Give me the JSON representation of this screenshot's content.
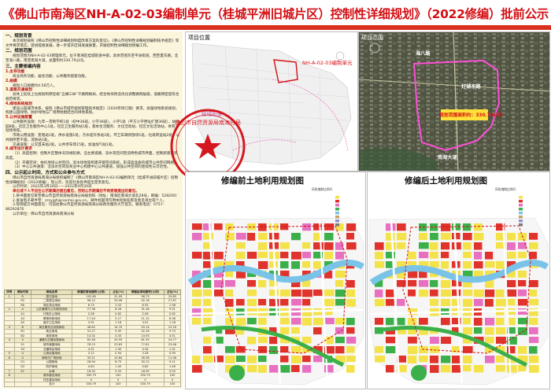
{
  "title": "《佛山市南海区NH-A-02-03编制单元（桂城平洲旧城片区）控制性详细规划》（2022修编）批前公示",
  "left": {
    "sec1_h": "一、规划背景",
    "sec1_p": "本次规划按照《佛山市控制性详细规划制度改革方案的意见》、《佛山市控制性详细规划编制技术规定》等文件要求落实，促进提质发展，进一步提升区域发展质量，开展控制性详细规划修编工作。",
    "sec2_h": "二、规划范围",
    "sec2_p": "规划范围为NH-A-02-03管理单元，位于南海区桂城街道中部，具体范围东至平洲街道，西至夏东路，北至海八路，南至南海大道，总面积约330.79公顷。",
    "sec3_h": "三、主要修编内容",
    "s1": "1.主导功能",
    "s1_p": "商业商务功能、居住功能、公共服务配套功能。",
    "s2": "2.规模",
    "s2_p": "规划人口规模约4.58万人。",
    "s3": "3.道路交通规划",
    "s3_p": "总体上延续上位规划和原控规“五横三纵”干路网格局，结合地块改造优化调整路网层级，道路网密度符合规范要求。",
    "s4": "4.绿地系统规划",
    "s4_p": "建设公园城市体系，按照《佛山市城市规划管理技术规定》（2020年修订版）要求，加强绿地系统规划，构建公园绿地、防护绿地与广场用地相结合的绿地系统。",
    "s5": "5.公共设施配置",
    "s5_p1": "公共服务设施：九年一贯制学校1处（初中36班，小学36班），小学1处（平方小学原址扩建36班），幼儿园8处，社区卫生服务中心1处，社区卫生服务站1处，基本生活服务、文化活动站、社区文化活动站、体育活动场地等。",
    "s5_p2": "市政公用设施：变电站1处，供水设施1处，污水提升泵站2处，环卫车辆停放场1处，垃圾转运站2处，公共厕所若干座，消防站1处。",
    "s5_p3": "交通设施：公交首末站2处，公共停车场15处，加油加气站1处。",
    "s6": "6.城市设计要求",
    "s6_p1": "（1）高度控制：控制片区整体天际线轮廓，沿主要道路、滨水等空间塑造特色城市界面，控制新建建筑高度。",
    "s6_p2": "（2）开敞空间：依托地块公共空间、滨水绿地等构建开敞空间系统，形成高品质的城市公共空间网络。",
    "s6_p3": "（3）中心公共通道：沿滨水空间及商业中心构建中心公共通道，加强公共空间的连续性与可达性。",
    "s7": "四、公示起止时间、方式和公众参与方式",
    "s7_p1": "佛山市自然资源局南海分局组织编制了《佛山市南海区NH-A-02-03编制单元（桂城平洲旧城片区）控制性详细规划》（2022修编），现公示，欢迎社会各界提出宝贵意见。",
    "s7_p2": "公示时间：2022年3月30日——2022年4月30日",
    "s7_p3": "单位或个人不应在公示期满后提出意见，否则公示期满后不再受理提出的意见。",
    "s7_p4": "1.将书面意见寄至佛山市自然资源局南海分局规划科（地址：南海区南海大道北28号，邮编：528200）",
    "s7_p5": "2.发送电子邮件至：zrzyjgh@nanhai.gov.cn，邮件标题须写明本控规名称及意见单位或个人。",
    "s7_p6": "3.现场提交书面意见：可前往佛山市自然资源局南海分局政务服务大厅提交。联系电话：0757-86292876",
    "org": "公示单位：佛山市自然资源局南海分局",
    "date": "2022年3月"
  },
  "table": {
    "headers": [
      "序号",
      "用地代码",
      "用地名称",
      "修编前用地面积(公顷)",
      "占比(%)",
      "修编后用地面积(公顷)",
      "占比(%)"
    ],
    "rows": [
      [
        "1",
        "R",
        "居住用地",
        "102.85",
        "31.09",
        "98.73",
        "29.85"
      ],
      [
        "",
        "R2",
        "二类居住用地",
        "96.12",
        "29.06",
        "92.18",
        "27.87"
      ],
      [
        "",
        "Rb",
        "商住混合用地",
        "6.73",
        "2.03",
        "6.55",
        "1.98"
      ],
      [
        "2",
        "A",
        "公共管理与公共服务用地",
        "27.38",
        "8.28",
        "31.46",
        "9.51"
      ],
      [
        "",
        "A1",
        "行政办公用地",
        "2.06",
        "0.62",
        "2.06",
        "0.62"
      ],
      [
        "",
        "A3",
        "教育科研用地",
        "17.44",
        "5.27",
        "21.12",
        "6.38"
      ],
      [
        "",
        "A5",
        "医疗卫生用地",
        "3.91",
        "1.18",
        "3.91",
        "1.18"
      ],
      [
        "3",
        "B",
        "商业服务业设施用地",
        "48.62",
        "14.70",
        "50.14",
        "15.16"
      ],
      [
        "",
        "B1",
        "商业用地",
        "31.27",
        "9.45",
        "32.18",
        "9.73"
      ],
      [
        "",
        "B2",
        "商务用地",
        "14.32",
        "4.33",
        "14.93",
        "4.51"
      ],
      [
        "4",
        "S",
        "道路与交通设施用地",
        "82.46",
        "24.93",
        "81.95",
        "24.77"
      ],
      [
        "",
        "S1",
        "城市道路用地",
        "78.15",
        "23.63",
        "77.61",
        "23.46"
      ],
      [
        "",
        "S4",
        "交通场站用地",
        "4.31",
        "1.30",
        "4.34",
        "1.31"
      ],
      [
        "5",
        "U",
        "公用设施用地",
        "3.12",
        "0.94",
        "3.28",
        "0.99"
      ],
      [
        "6",
        "G",
        "绿地与广场用地",
        "35.21",
        "10.64",
        "36.58",
        "11.06"
      ],
      [
        "",
        "G1",
        "公园绿地",
        "28.94",
        "8.75",
        "30.12",
        "9.11"
      ],
      [
        "",
        "G2",
        "防护绿地",
        "4.63",
        "1.40",
        "4.82",
        "1.46"
      ],
      [
        "7",
        "E1",
        "水域",
        "18.35",
        "5.55",
        "18.35",
        "5.55"
      ],
      [
        "8",
        "",
        "城市建设用地",
        "330.79",
        "100",
        "330.79",
        "100"
      ],
      [
        "",
        "",
        "村庄建设用地",
        "0",
        "0",
        "0",
        "0"
      ],
      [
        "",
        "",
        "总计",
        "330.79",
        "100",
        "330.79",
        "100"
      ]
    ]
  },
  "map1": {
    "label": "项目位置",
    "unit": "NH-A-02-03编制单元",
    "area": "桂城街道"
  },
  "map2": {
    "label": "项目范围",
    "road1": "海八路",
    "road2": "灯湖东路",
    "road3": "南海大道",
    "area": "规划范围面积约：330.79公顷"
  },
  "stamp": {
    "text": "佛山市自然资源局南海分局"
  },
  "map3": {
    "title": "修编前土地利用规划图",
    "legend": "风玫瑰和比例尺"
  },
  "map4": {
    "title": "修编后土地利用规划图",
    "legend": "风玫瑰和比例尺"
  },
  "colors": {
    "title": "#d40f14",
    "residential": "#f3e24a",
    "commercial": "#e0332c",
    "public": "#e870c0",
    "green": "#3bb04a",
    "water": "#7ac3e8",
    "road": "#ffffff"
  }
}
